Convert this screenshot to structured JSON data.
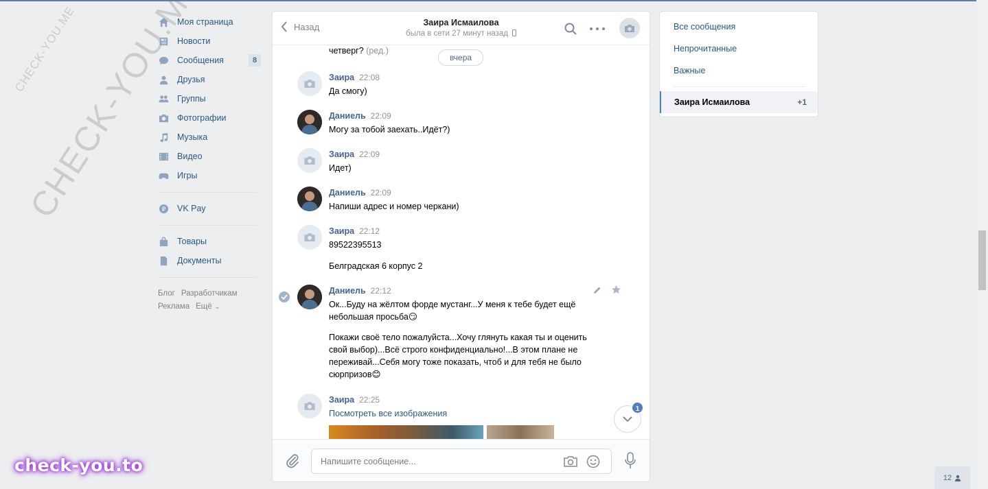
{
  "nav": {
    "items": [
      {
        "label": "Моя страница",
        "icon": "home-icon"
      },
      {
        "label": "Новости",
        "icon": "news-icon"
      },
      {
        "label": "Сообщения",
        "icon": "messages-icon",
        "badge": "8"
      },
      {
        "label": "Друзья",
        "icon": "friends-icon"
      },
      {
        "label": "Группы",
        "icon": "groups-icon"
      },
      {
        "label": "Фотографии",
        "icon": "photos-icon"
      },
      {
        "label": "Музыка",
        "icon": "music-icon"
      },
      {
        "label": "Видео",
        "icon": "video-icon"
      },
      {
        "label": "Игры",
        "icon": "games-icon"
      }
    ],
    "vkpay": "VK Pay",
    "market": "Товары",
    "docs": "Документы",
    "footer": {
      "blog": "Блог",
      "dev": "Разработчикам",
      "ads": "Реклама",
      "more": "Ещё"
    }
  },
  "chat": {
    "back_label": "Назад",
    "peer_name": "Заира Исмаилова",
    "peer_status": "была в сети 27 минут назад",
    "date_divider": "вчера",
    "prev_text": "четверг?",
    "prev_edited": "(ред.)",
    "messages": [
      {
        "author": "Заира",
        "time": "22:08",
        "text": "Да смогу)"
      },
      {
        "author": "Даниель",
        "time": "22:09",
        "text": "Могу за тобой заехать..Идёт?)"
      },
      {
        "author": "Заира",
        "time": "22:09",
        "text": "Идет)"
      },
      {
        "author": "Даниель",
        "time": "22:09",
        "text": "Напиши адрес и номер черкани)"
      },
      {
        "author": "Заира",
        "time": "22:12",
        "text": "89522395513",
        "text2": "Белградская 6 корпус 2"
      },
      {
        "author": "Даниель",
        "time": "22:12",
        "text": "Ок...Буду на жёлтом форде мустанг...У меня к тебе будет ещё небольшая просьба😏",
        "text2": "Покажи своё тело пожалуйста...Хочу глянуть какая ты и оценить свой выбор)...Всё строго конфиденциально!...В этом плане не переживай...Себя могу тоже показать, чтоб и для тебя не было сюрпризов😊"
      },
      {
        "author": "Заира",
        "time": "22:25",
        "text": "Посмотреть все изображения"
      }
    ],
    "unread_badge": "1",
    "composer_placeholder": "Напишите сообщение..."
  },
  "filters": {
    "all": "Все сообщения",
    "unread": "Непрочитанные",
    "important": "Важные",
    "conversation_name": "Заира Исмаилова",
    "conversation_count": "+1"
  },
  "chatbox_count": "12",
  "watermarks": {
    "diag_small": "CHECK-YOU.ME",
    "diag_big": "CHECK-YOU.ME",
    "logo": "check-you.to"
  },
  "colors": {
    "link": "#2a5885",
    "name": "#42648b",
    "accent": "#5181b8",
    "bg": "#edeef0"
  }
}
